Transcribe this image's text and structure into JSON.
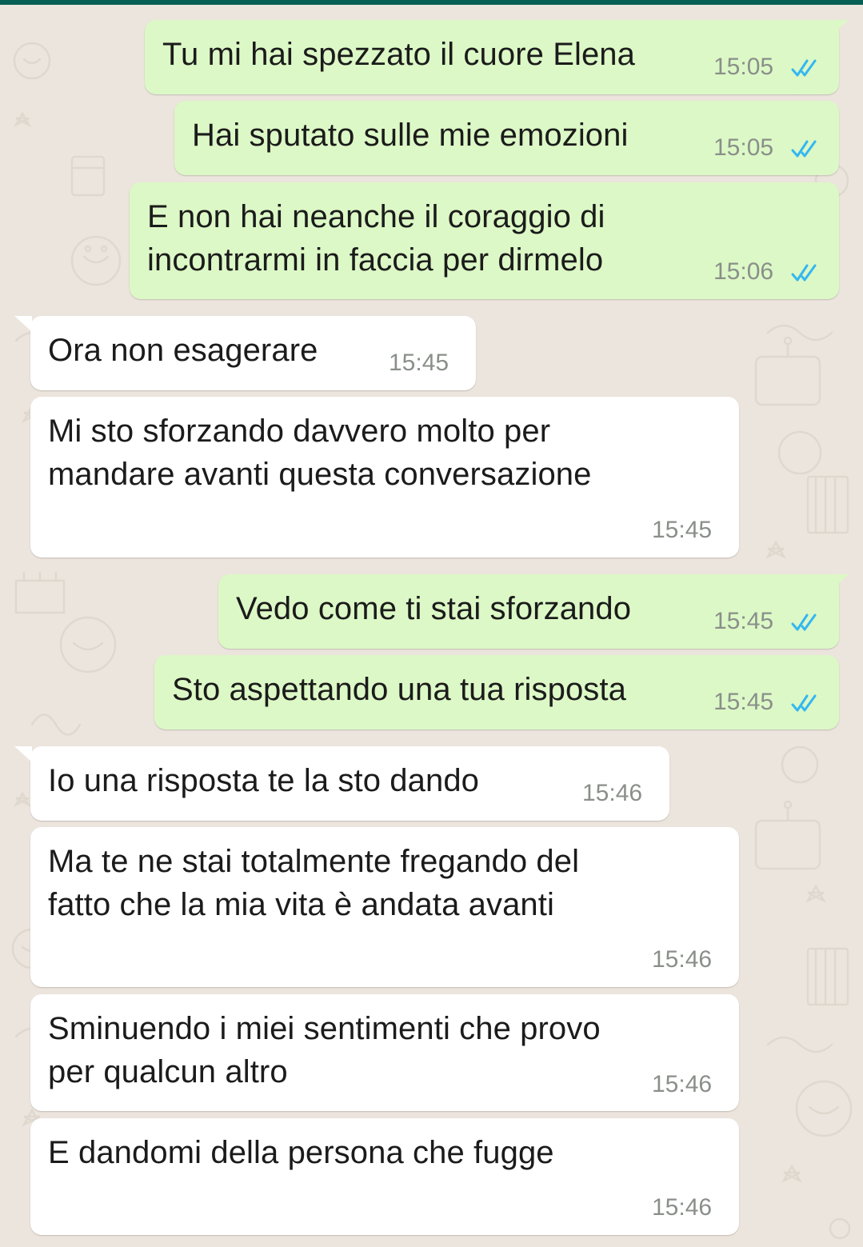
{
  "app": {
    "header_color": "#075E54",
    "outgoing_bubble_color": "#DCF8C6",
    "incoming_bubble_color": "#FFFFFF",
    "read_tick_color": "#34B7F1",
    "wallpaper_color": "#ECE5DD"
  },
  "messages": [
    {
      "direction": "out",
      "text": "Tu mi hai spezzato il cuore Elena",
      "time": "15:05",
      "status": "read-double-check-icon"
    },
    {
      "direction": "out",
      "text": "Hai sputato sulle mie emozioni",
      "time": "15:05",
      "status": "read-double-check-icon"
    },
    {
      "direction": "out",
      "text": "E non hai neanche il coraggio di\nincontrarmi in faccia per dirmelo",
      "time": "15:06",
      "status": "read-double-check-icon"
    },
    {
      "direction": "in",
      "text": "Ora non esagerare",
      "time": "15:45"
    },
    {
      "direction": "in",
      "text": "Mi sto sforzando davvero molto per\nmandare avanti questa conversazione",
      "time": "15:45"
    },
    {
      "direction": "out",
      "text": "Vedo come ti stai sforzando",
      "time": "15:45",
      "status": "read-double-check-icon"
    },
    {
      "direction": "out",
      "text": "Sto aspettando una tua risposta",
      "time": "15:45",
      "status": "read-double-check-icon"
    },
    {
      "direction": "in",
      "text": "Io una risposta te la sto dando",
      "time": "15:46"
    },
    {
      "direction": "in",
      "text": "Ma te ne stai totalmente fregando del\nfatto che la mia vita è andata avanti",
      "time": "15:46"
    },
    {
      "direction": "in",
      "text": "Sminuendo i miei sentimenti che provo\nper qualcun altro",
      "time": "15:46"
    },
    {
      "direction": "in",
      "text": "E dandomi della persona che fugge",
      "time": "15:46"
    }
  ]
}
